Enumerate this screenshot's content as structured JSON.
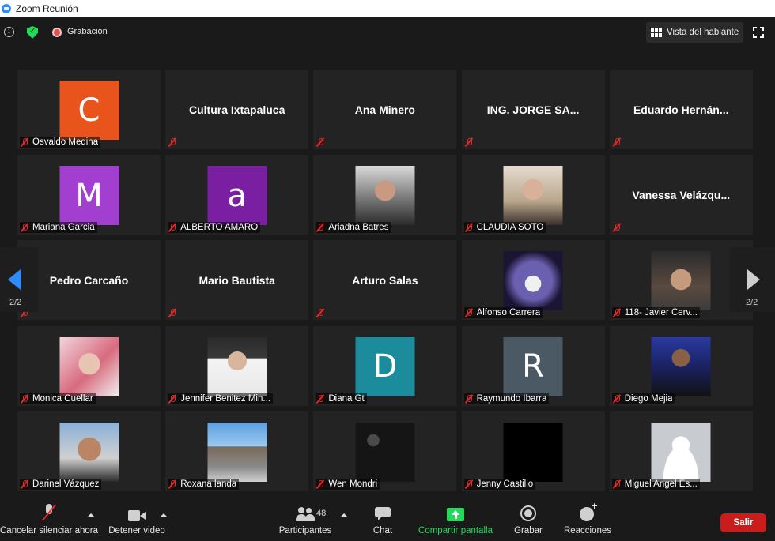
{
  "window": {
    "title": "Zoom Reunión"
  },
  "topbar": {
    "recording_label": "Grabación",
    "view_label": "Vista del hablante"
  },
  "pagination": {
    "left": "2/2",
    "right": "2/2"
  },
  "tiles": [
    {
      "name": "Osvaldo Medina",
      "kind": "avatar",
      "letter": "C",
      "color": "#e8541c"
    },
    {
      "name": "Cultura Ixtapaluca",
      "kind": "text"
    },
    {
      "name": "Ana Minero",
      "kind": "text"
    },
    {
      "name": "ING. JORGE SA...",
      "kind": "text"
    },
    {
      "name": "Eduardo  Hernán...",
      "kind": "text"
    },
    {
      "name": "Mariana Garcia",
      "kind": "avatar",
      "letter": "M",
      "color": "#a23ed0"
    },
    {
      "name": "ALBERTO AMARO",
      "kind": "avatar",
      "letter": "a",
      "color": "#7b1fa2"
    },
    {
      "name": "Ariadna Batres",
      "kind": "photo",
      "photo": "woman-photo-1"
    },
    {
      "name": "CLAUDIA SOTO",
      "kind": "photo",
      "photo": "woman-photo-2"
    },
    {
      "name": "Vanessa  Velázqu...",
      "kind": "text"
    },
    {
      "name": "Pedro Carcaño",
      "kind": "text"
    },
    {
      "name": "Mario Bautista",
      "kind": "text"
    },
    {
      "name": "Arturo Salas",
      "kind": "text"
    },
    {
      "name": "Alfonso Carrera",
      "kind": "photo",
      "photo": "knight-mask-photo"
    },
    {
      "name": "118- Javier Cerv...",
      "kind": "photo",
      "photo": "man-glasses-photo"
    },
    {
      "name": "Monica Cuellar",
      "kind": "photo",
      "photo": "woman-photo-3"
    },
    {
      "name": "Jennifer Benitez Min...",
      "kind": "photo",
      "photo": "woman-photo-4"
    },
    {
      "name": "Diana Gt",
      "kind": "avatar",
      "letter": "D",
      "color": "#1a8c9c"
    },
    {
      "name": "Raymundo Ibarra",
      "kind": "avatar",
      "letter": "R",
      "color": "#4a5963"
    },
    {
      "name": "Diego Mejia",
      "kind": "photo",
      "photo": "man-suit-photo"
    },
    {
      "name": "Darinel Vázquez",
      "kind": "photo",
      "photo": "man-selfie-photo"
    },
    {
      "name": "Roxana landa",
      "kind": "photo",
      "photo": "street-photo"
    },
    {
      "name": "Wen Mondri",
      "kind": "photo",
      "photo": "quote-photo"
    },
    {
      "name": "Jenny Castillo",
      "kind": "photo",
      "photo": "black-photo"
    },
    {
      "name": "Miguel Angel Es...",
      "kind": "photo",
      "photo": "default-user-photo"
    }
  ],
  "toolbar": {
    "mute_label": "Cancelar silenciar ahora",
    "video_label": "Detener video",
    "participants_label": "Participantes",
    "participants_count": "48",
    "chat_label": "Chat",
    "share_label": "Compartir pantalla",
    "record_label": "Grabar",
    "reactions_label": "Reacciones",
    "leave_label": "Salir"
  },
  "colors": {
    "share_green": "#23d959",
    "leave_red": "#c91d1d",
    "accent_blue": "#2d8cff"
  }
}
